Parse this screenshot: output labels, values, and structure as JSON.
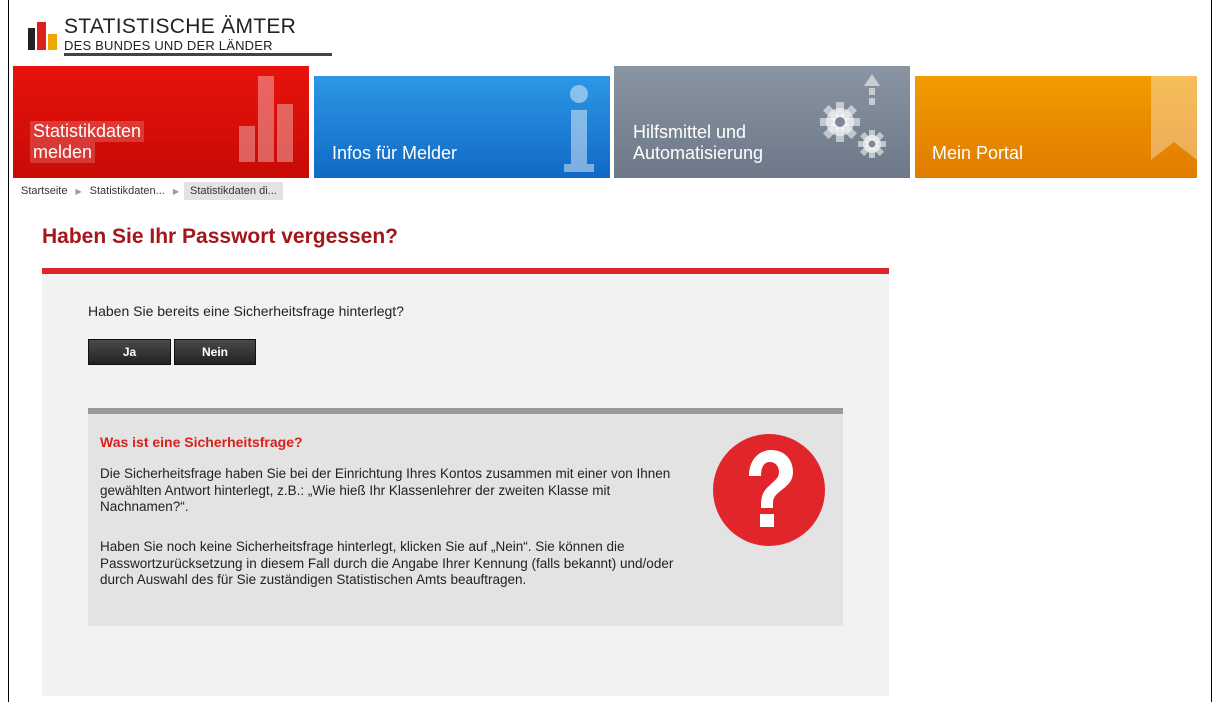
{
  "logo": {
    "line1": "STATISTISCHE ÄMTER",
    "line2": "DES BUNDES UND DER LÄNDER"
  },
  "nav": {
    "tiles": [
      {
        "label_line1": "Statistikdaten",
        "label_line2": "melden",
        "color": "#e8120c"
      },
      {
        "label": "Infos für Melder",
        "color": "#1e82d6"
      },
      {
        "label_line1": "Hilfsmittel und",
        "label_line2": "Automatisierung",
        "color": "#7f8a98"
      },
      {
        "label": "Mein Portal",
        "color": "#f08c00"
      }
    ]
  },
  "breadcrumb": {
    "items": [
      "Startseite",
      "Statistikdaten...",
      "Statistikdaten di..."
    ]
  },
  "page": {
    "title": "Haben Sie Ihr Passwort vergessen?",
    "question": "Haben Sie bereits eine Sicherheitsfrage hinterlegt?",
    "buttons": {
      "yes": "Ja",
      "no": "Nein"
    }
  },
  "info": {
    "title": "Was ist eine Sicherheitsfrage?",
    "paragraph1": "Die Sicherheitsfrage haben Sie bei der Einrichtung Ihres Kontos zusammen mit einer von Ihnen gewählten Antwort hinterlegt, z.B.: „Wie hieß Ihr Klassenlehrer der zweiten Klasse mit Nachnamen?“.",
    "paragraph2": "Haben Sie noch keine Sicherheitsfrage hinterlegt, klicken Sie auf „Nein“. Sie können die Passwortzurücksetzung in diesem Fall durch die Angabe Ihrer Kennung (falls bekannt) und/oder durch Auswahl des für Sie zuständigen Statistischen Amts beauftragen.",
    "icon": "question-mark-icon",
    "icon_color": "#e0262b"
  },
  "colors": {
    "accent_red": "#a4161a",
    "rule_red": "#e0262b"
  }
}
